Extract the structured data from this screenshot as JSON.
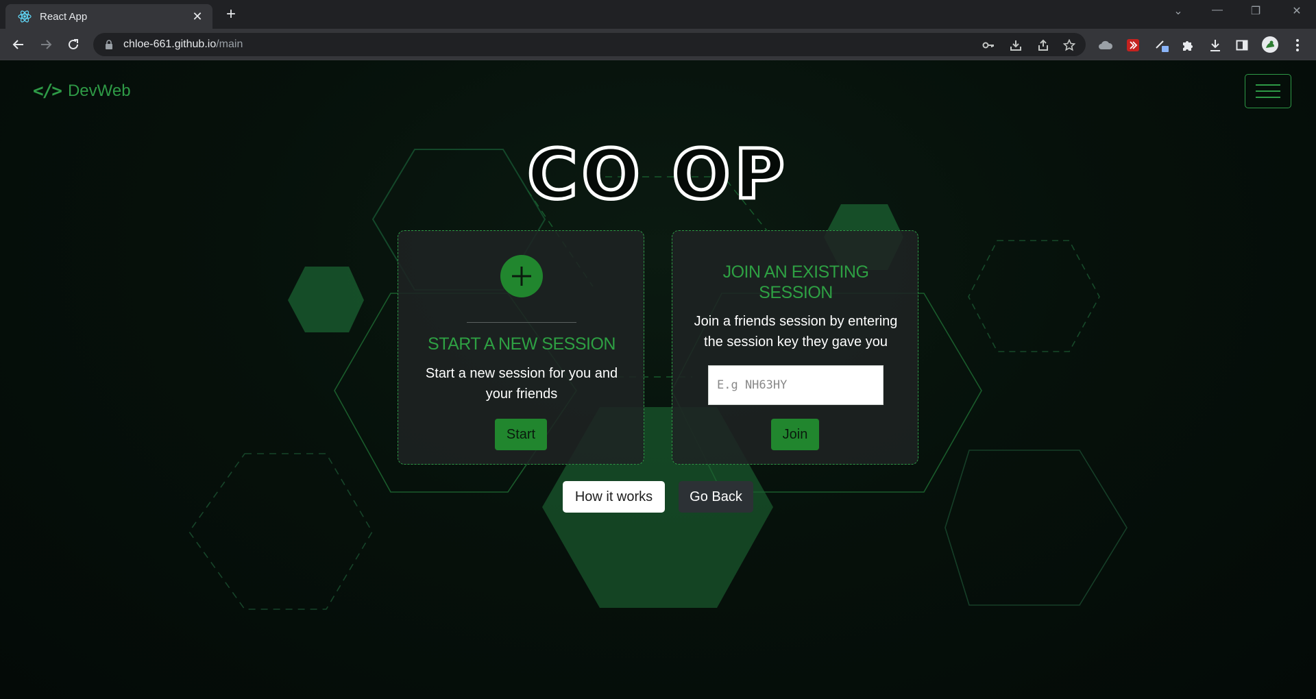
{
  "browser": {
    "tab_title": "React App",
    "new_tab_symbol": "+",
    "tab_close_symbol": "✕",
    "url_host": "chloe-661.github.io",
    "url_path": "/main",
    "window_controls": {
      "dropdown": "⌄",
      "minimize": "—",
      "restore": "❐",
      "close": "✕"
    }
  },
  "navbar": {
    "brand_logo": "</>",
    "brand_name": "DevWeb"
  },
  "hero": {
    "title": "CO OP"
  },
  "new_session": {
    "heading": "START A NEW SESSION",
    "text": "Start a new session for you and your friends",
    "button": "Start"
  },
  "join_session": {
    "heading": "JOIN AN EXISTING SESSION",
    "text": "Join a friends session by entering the session key they gave you",
    "input_value": "",
    "input_placeholder": "E.g NH63HY",
    "button": "Join"
  },
  "actions": {
    "how_it_works": "How it works",
    "go_back": "Go Back"
  },
  "colors": {
    "accent": "#2ea043",
    "button_green": "#21862e",
    "background": "#050a07",
    "card": "#1e2323"
  }
}
